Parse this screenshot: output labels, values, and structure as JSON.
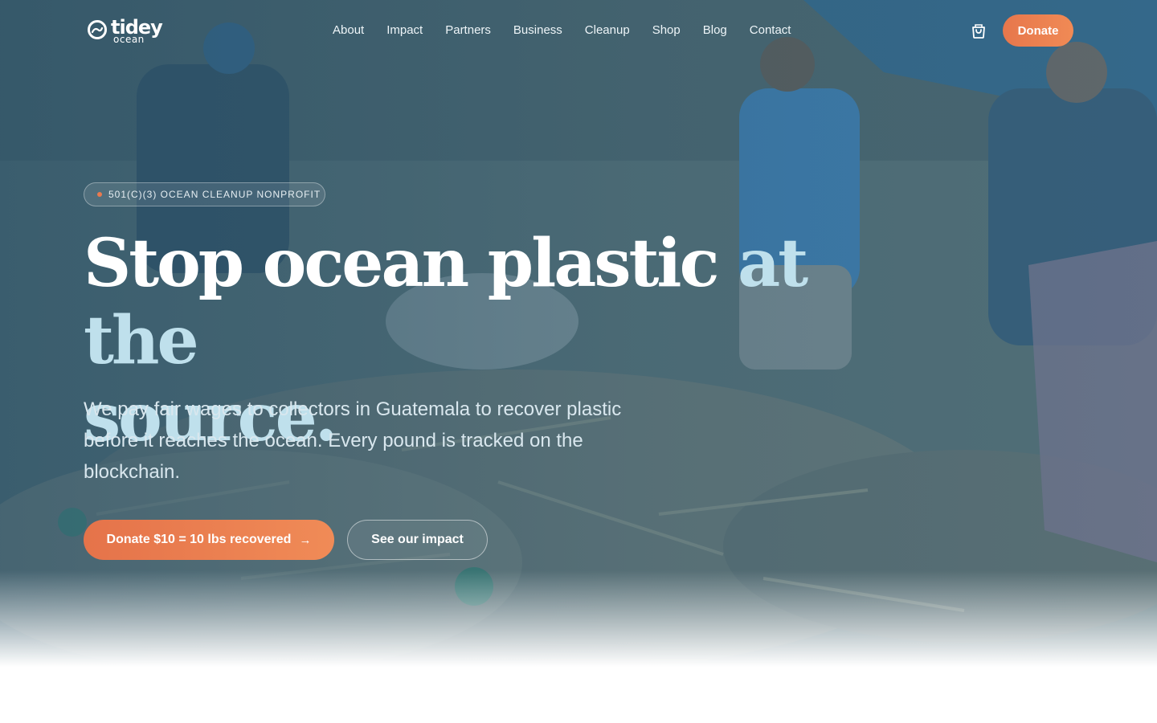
{
  "brand": {
    "name": "tidey",
    "sub": "ocean"
  },
  "nav": {
    "items": [
      {
        "label": "About"
      },
      {
        "label": "Impact"
      },
      {
        "label": "Partners"
      },
      {
        "label": "Business"
      },
      {
        "label": "Cleanup"
      },
      {
        "label": "Shop"
      },
      {
        "label": "Blog"
      },
      {
        "label": "Contact"
      }
    ],
    "cart_icon": "shopping-bag-icon",
    "donate_label": "Donate"
  },
  "hero": {
    "badge": "501(C)(3) OCEAN CLEANUP NONPROFIT",
    "headline_main": "Stop ocean plastic ",
    "headline_accent_1": "at the",
    "headline_accent_2": "source.",
    "lede": "We pay fair wages to collectors in Guatemala to recover plastic before it reaches the ocean. Every pound is tracked on the blockchain.",
    "cta_primary": "Donate $10 = 10 lbs recovered",
    "cta_primary_icon": "arrow-right-icon",
    "cta_secondary": "See our impact"
  },
  "colors": {
    "accent": "#EE804F",
    "headline_accent": "#BFE0EC",
    "overlay": "#2F5F78"
  }
}
